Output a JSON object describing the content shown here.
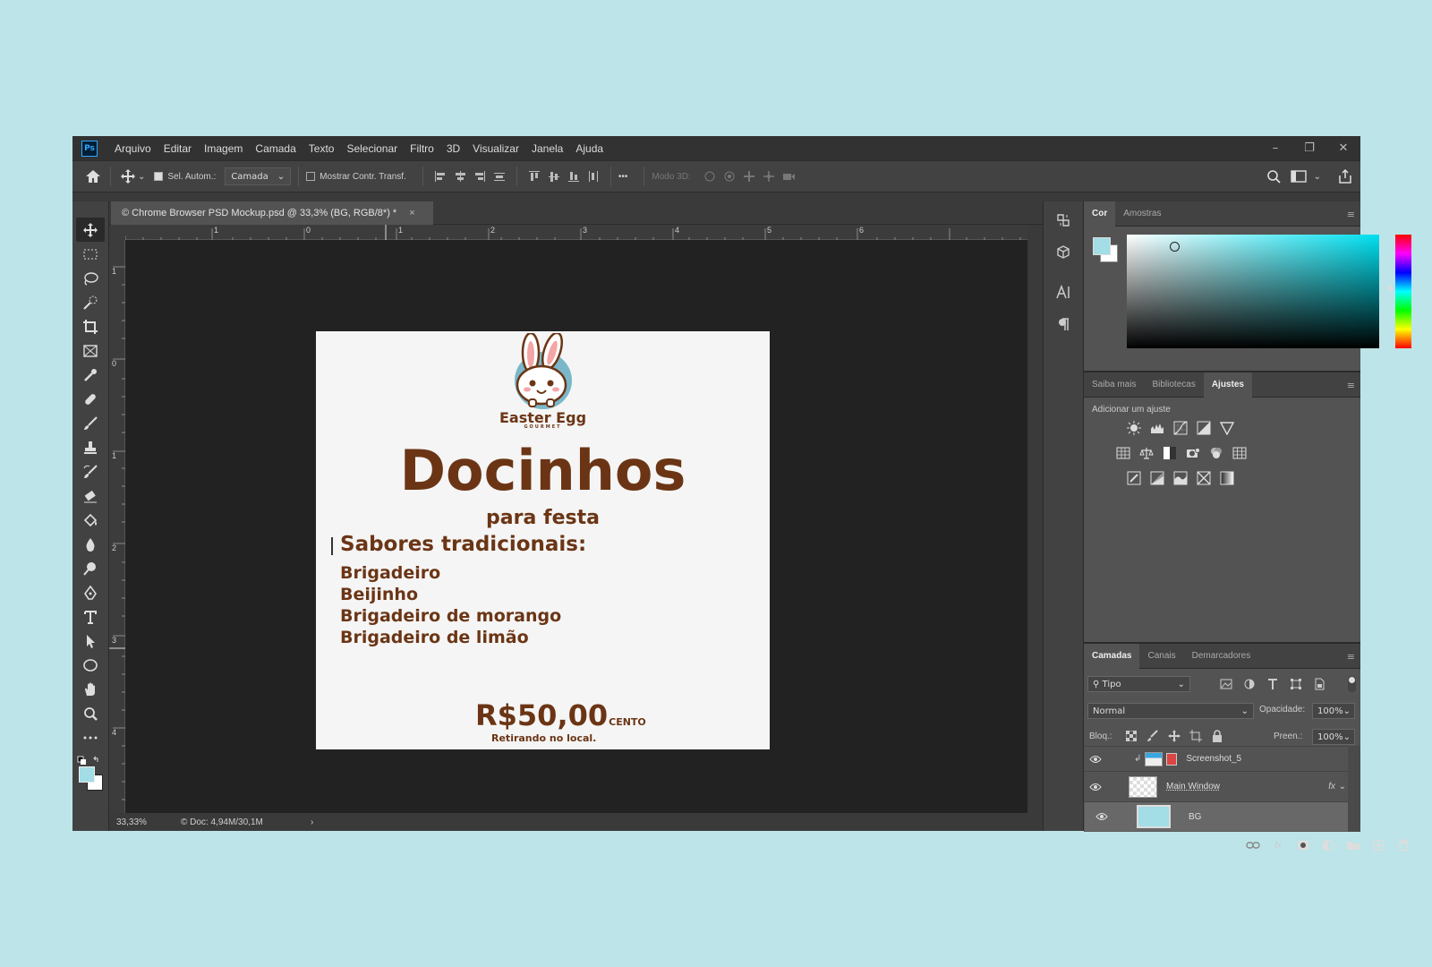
{
  "app": {
    "logo": "Ps"
  },
  "menu": [
    "Arquivo",
    "Editar",
    "Imagem",
    "Camada",
    "Texto",
    "Selecionar",
    "Filtro",
    "3D",
    "Visualizar",
    "Janela",
    "Ajuda"
  ],
  "window_controls": {
    "minimize": "–",
    "restore": "❐",
    "close": "✕"
  },
  "options": {
    "auto_select_label": "Sel. Autom.:",
    "auto_select_value": "Camada",
    "show_transform_label": "Mostrar Contr. Transf.",
    "more": "•••",
    "mode3d_label": "Modo 3D:"
  },
  "document": {
    "tab_title": "© Chrome Browser PSD Mockup.psd @ 33,3% (BG, RGB/8*) *",
    "tab_close": "×",
    "ruler_h": [
      "1",
      "0",
      "1",
      "2",
      "3",
      "4",
      "5",
      "6"
    ],
    "ruler_v": [
      "1",
      "0",
      "1",
      "2",
      "3",
      "4"
    ],
    "zoom": "33,33%",
    "doc_info": "© Doc: 4,94M/30,1M",
    "status_arrow": "›"
  },
  "artwork": {
    "brand": "Easter Egg",
    "brand_sub": "GOURMET",
    "title": "Docinhos",
    "subtitle": "para festa",
    "heading": "Sabores tradicionais:",
    "items": [
      "Brigadeiro",
      "Beijinho",
      "Brigadeiro de morango",
      "Brigadeiro de limão"
    ],
    "price": "R$50,00",
    "price_unit": "CENTO",
    "pickup": "Retirando no local."
  },
  "panels": {
    "color_tabs": [
      "Cor",
      "Amostras"
    ],
    "adj_tabs": [
      "Saiba mais",
      "Bibliotecas",
      "Ajustes"
    ],
    "adj_label": "Adicionar um ajuste",
    "layer_tabs": [
      "Camadas",
      "Canais",
      "Demarcadores"
    ],
    "filter_kind": "Tipo",
    "blend_mode": "Normal",
    "opacity_label": "Opacidade:",
    "opacity_value": "100%",
    "lock_label": "Bloq.:",
    "fill_label": "Preen.:",
    "fill_value": "100%",
    "fx": "fx",
    "layers": [
      {
        "name": "Screenshot_5"
      },
      {
        "name": "Main Window"
      },
      {
        "name": "BG"
      }
    ]
  },
  "colors": {
    "foreground": "#a3dde6",
    "background": "#ffffff",
    "brown": "#6b3515"
  }
}
